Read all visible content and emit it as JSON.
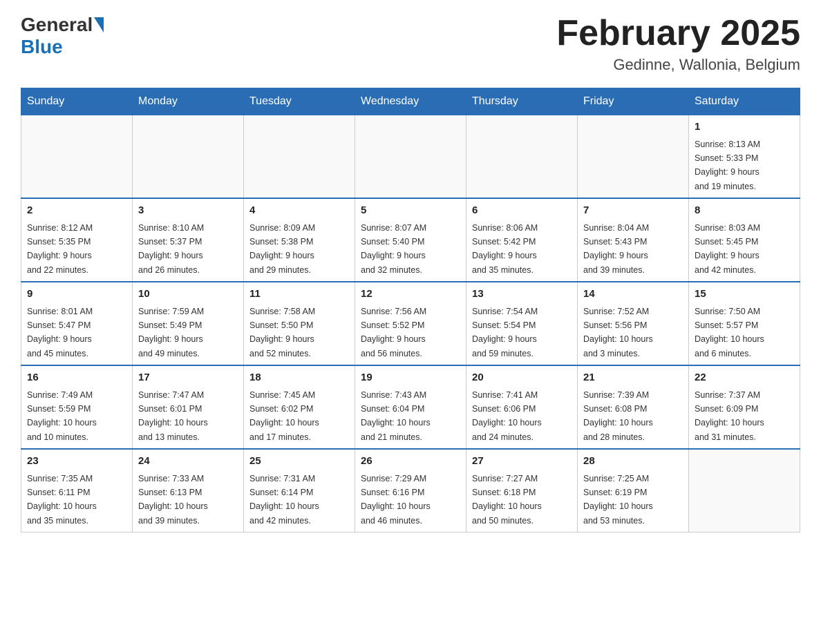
{
  "header": {
    "title": "February 2025",
    "location": "Gedinne, Wallonia, Belgium",
    "logo_general": "General",
    "logo_blue": "Blue"
  },
  "days_of_week": [
    "Sunday",
    "Monday",
    "Tuesday",
    "Wednesday",
    "Thursday",
    "Friday",
    "Saturday"
  ],
  "weeks": [
    [
      {
        "day": "",
        "info": ""
      },
      {
        "day": "",
        "info": ""
      },
      {
        "day": "",
        "info": ""
      },
      {
        "day": "",
        "info": ""
      },
      {
        "day": "",
        "info": ""
      },
      {
        "day": "",
        "info": ""
      },
      {
        "day": "1",
        "info": "Sunrise: 8:13 AM\nSunset: 5:33 PM\nDaylight: 9 hours\nand 19 minutes."
      }
    ],
    [
      {
        "day": "2",
        "info": "Sunrise: 8:12 AM\nSunset: 5:35 PM\nDaylight: 9 hours\nand 22 minutes."
      },
      {
        "day": "3",
        "info": "Sunrise: 8:10 AM\nSunset: 5:37 PM\nDaylight: 9 hours\nand 26 minutes."
      },
      {
        "day": "4",
        "info": "Sunrise: 8:09 AM\nSunset: 5:38 PM\nDaylight: 9 hours\nand 29 minutes."
      },
      {
        "day": "5",
        "info": "Sunrise: 8:07 AM\nSunset: 5:40 PM\nDaylight: 9 hours\nand 32 minutes."
      },
      {
        "day": "6",
        "info": "Sunrise: 8:06 AM\nSunset: 5:42 PM\nDaylight: 9 hours\nand 35 minutes."
      },
      {
        "day": "7",
        "info": "Sunrise: 8:04 AM\nSunset: 5:43 PM\nDaylight: 9 hours\nand 39 minutes."
      },
      {
        "day": "8",
        "info": "Sunrise: 8:03 AM\nSunset: 5:45 PM\nDaylight: 9 hours\nand 42 minutes."
      }
    ],
    [
      {
        "day": "9",
        "info": "Sunrise: 8:01 AM\nSunset: 5:47 PM\nDaylight: 9 hours\nand 45 minutes."
      },
      {
        "day": "10",
        "info": "Sunrise: 7:59 AM\nSunset: 5:49 PM\nDaylight: 9 hours\nand 49 minutes."
      },
      {
        "day": "11",
        "info": "Sunrise: 7:58 AM\nSunset: 5:50 PM\nDaylight: 9 hours\nand 52 minutes."
      },
      {
        "day": "12",
        "info": "Sunrise: 7:56 AM\nSunset: 5:52 PM\nDaylight: 9 hours\nand 56 minutes."
      },
      {
        "day": "13",
        "info": "Sunrise: 7:54 AM\nSunset: 5:54 PM\nDaylight: 9 hours\nand 59 minutes."
      },
      {
        "day": "14",
        "info": "Sunrise: 7:52 AM\nSunset: 5:56 PM\nDaylight: 10 hours\nand 3 minutes."
      },
      {
        "day": "15",
        "info": "Sunrise: 7:50 AM\nSunset: 5:57 PM\nDaylight: 10 hours\nand 6 minutes."
      }
    ],
    [
      {
        "day": "16",
        "info": "Sunrise: 7:49 AM\nSunset: 5:59 PM\nDaylight: 10 hours\nand 10 minutes."
      },
      {
        "day": "17",
        "info": "Sunrise: 7:47 AM\nSunset: 6:01 PM\nDaylight: 10 hours\nand 13 minutes."
      },
      {
        "day": "18",
        "info": "Sunrise: 7:45 AM\nSunset: 6:02 PM\nDaylight: 10 hours\nand 17 minutes."
      },
      {
        "day": "19",
        "info": "Sunrise: 7:43 AM\nSunset: 6:04 PM\nDaylight: 10 hours\nand 21 minutes."
      },
      {
        "day": "20",
        "info": "Sunrise: 7:41 AM\nSunset: 6:06 PM\nDaylight: 10 hours\nand 24 minutes."
      },
      {
        "day": "21",
        "info": "Sunrise: 7:39 AM\nSunset: 6:08 PM\nDaylight: 10 hours\nand 28 minutes."
      },
      {
        "day": "22",
        "info": "Sunrise: 7:37 AM\nSunset: 6:09 PM\nDaylight: 10 hours\nand 31 minutes."
      }
    ],
    [
      {
        "day": "23",
        "info": "Sunrise: 7:35 AM\nSunset: 6:11 PM\nDaylight: 10 hours\nand 35 minutes."
      },
      {
        "day": "24",
        "info": "Sunrise: 7:33 AM\nSunset: 6:13 PM\nDaylight: 10 hours\nand 39 minutes."
      },
      {
        "day": "25",
        "info": "Sunrise: 7:31 AM\nSunset: 6:14 PM\nDaylight: 10 hours\nand 42 minutes."
      },
      {
        "day": "26",
        "info": "Sunrise: 7:29 AM\nSunset: 6:16 PM\nDaylight: 10 hours\nand 46 minutes."
      },
      {
        "day": "27",
        "info": "Sunrise: 7:27 AM\nSunset: 6:18 PM\nDaylight: 10 hours\nand 50 minutes."
      },
      {
        "day": "28",
        "info": "Sunrise: 7:25 AM\nSunset: 6:19 PM\nDaylight: 10 hours\nand 53 minutes."
      },
      {
        "day": "",
        "info": ""
      }
    ]
  ]
}
